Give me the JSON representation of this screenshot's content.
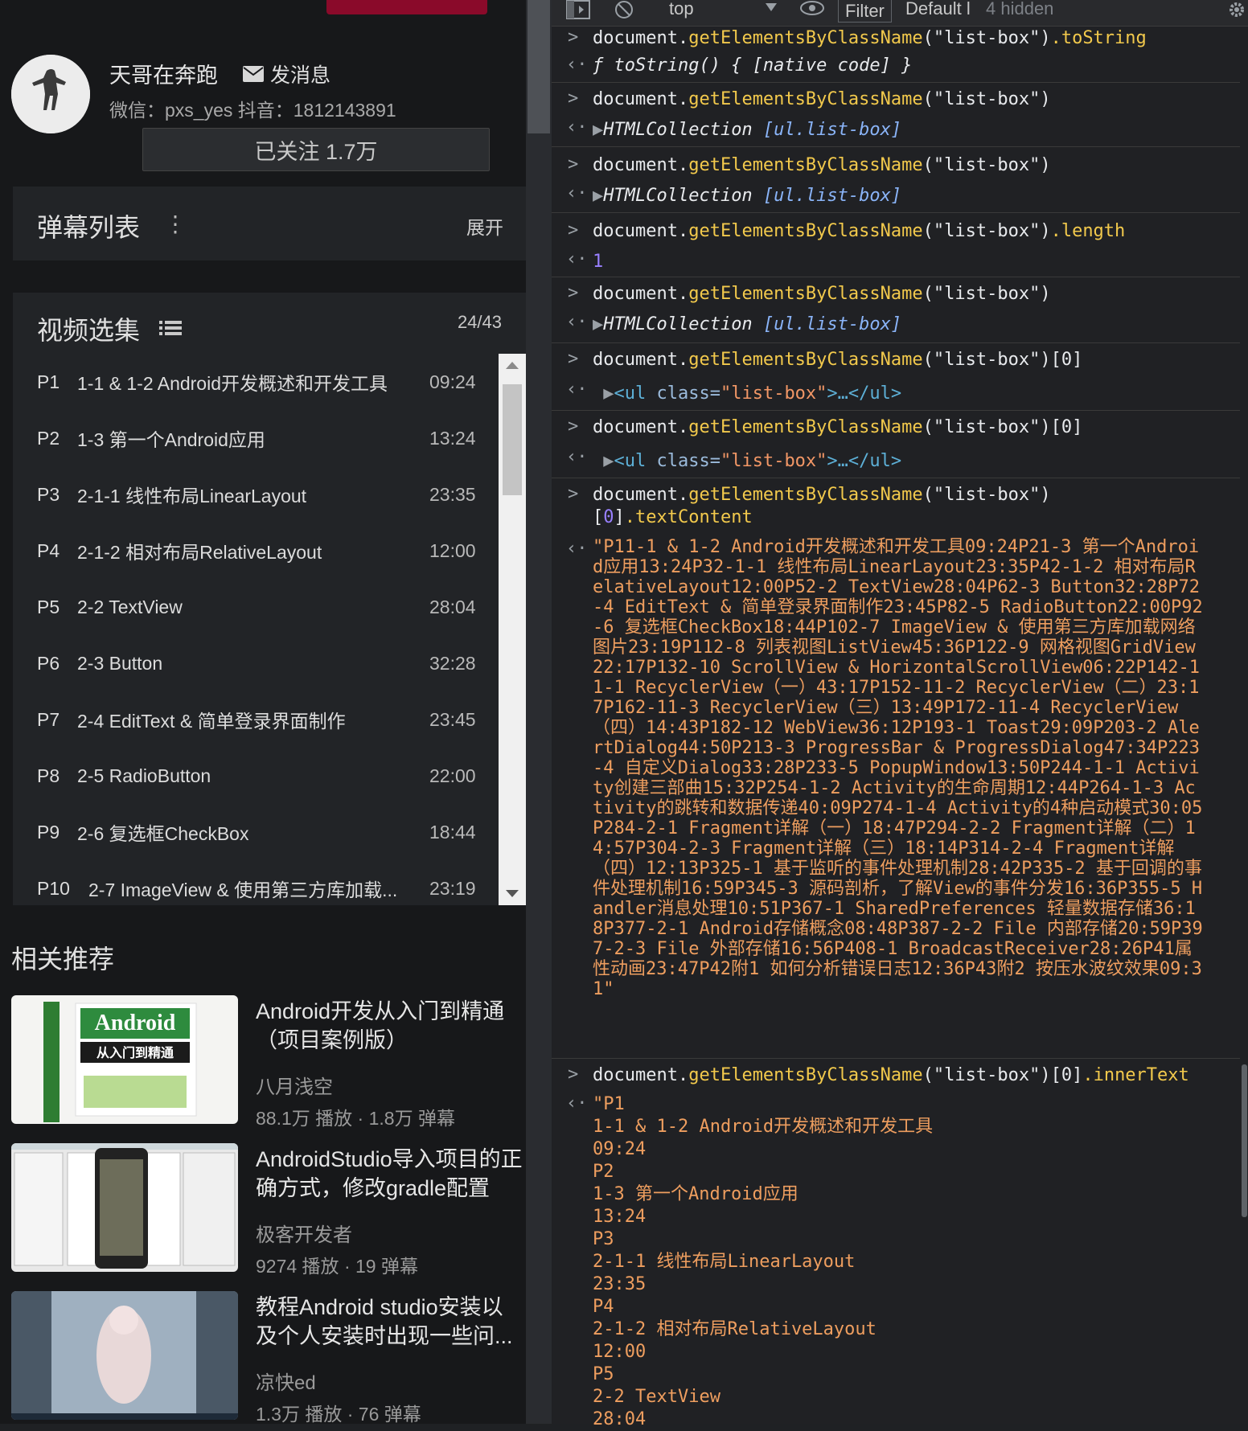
{
  "uploader": {
    "name": "天哥在奔跑",
    "message_label": "发消息",
    "description": "微信：pxs_yes 抖音：1812143891",
    "follow_label": "已关注 1.7万"
  },
  "danmu": {
    "title": "弹幕列表",
    "expand_label": "展开"
  },
  "video_selection": {
    "title": "视频选集",
    "count": "24/43",
    "items": [
      {
        "p": "P1",
        "title": "1-1 & 1-2 Android开发概述和开发工具",
        "duration": "09:24"
      },
      {
        "p": "P2",
        "title": "1-3 第一个Android应用",
        "duration": "13:24"
      },
      {
        "p": "P3",
        "title": "2-1-1 线性布局LinearLayout",
        "duration": "23:35"
      },
      {
        "p": "P4",
        "title": "2-1-2 相对布局RelativeLayout",
        "duration": "12:00"
      },
      {
        "p": "P5",
        "title": "2-2 TextView",
        "duration": "28:04"
      },
      {
        "p": "P6",
        "title": "2-3 Button",
        "duration": "32:28"
      },
      {
        "p": "P7",
        "title": "2-4 EditText & 简单登录界面制作",
        "duration": "23:45"
      },
      {
        "p": "P8",
        "title": "2-5 RadioButton",
        "duration": "22:00"
      },
      {
        "p": "P9",
        "title": "2-6 复选框CheckBox",
        "duration": "18:44"
      },
      {
        "p": "P10",
        "title": "2-7 ImageView & 使用第三方库加载...",
        "duration": "23:19"
      }
    ]
  },
  "recommend": {
    "title": "相关推荐",
    "items": [
      {
        "title": "Android开发从入门到精通（项目案例版）",
        "author": "八月浅空",
        "stats": "88.1万 播放 · 1.8万 弹幕",
        "thumb_text": "Android",
        "thumb_sub": "从入门到精通"
      },
      {
        "title": "AndroidStudio导入项目的正确方式，修改gradle配置",
        "author": "极客开发者",
        "stats": "9274 播放 · 19 弹幕"
      },
      {
        "title": "教程Android studio安装以及个人安装时出现一些问...",
        "author": "凉快ed",
        "stats": "1.3万 播放 · 76 弹幕"
      }
    ]
  },
  "devtools": {
    "toolbar": {
      "context": "top",
      "filter_placeholder": "Filter",
      "levels": "Default l",
      "hidden": "4 hidden"
    },
    "console": {
      "doc": "document.",
      "fn": "getElementsByClassName",
      "arg": "(\"list-box\")",
      "tostring_prop": ".toString",
      "tostring_result": "ƒ toString() { [native code] }",
      "collection_label": "HTMLCollection",
      "collection_content": "[ul.list-box]",
      "length_prop": ".length",
      "length_value": "1",
      "index": "[0]",
      "index_digit": "0",
      "ul_open": "<ul",
      "ul_attr": " class=",
      "ul_attr_val": "\"list-box\"",
      "ul_close": ">…</ul>",
      "textcontent_prop": ".textContent",
      "innertext_prop": ".innerText",
      "textcontent_result": "\"P11-1 & 1-2 Android开发概述和开发工具09:24P21-3 第一个Android应用13:24P32-1-1 线性布局LinearLayout23:35P42-1-2 相对布局RelativeLayout12:00P52-2 TextView28:04P62-3 Button32:28P72-4 EditText & 简单登录界面制作23:45P82-5 RadioButton22:00P92-6 复选框CheckBox18:44P102-7 ImageView & 使用第三方库加载网络图片23:19P112-8 列表视图ListView45:36P122-9 网格视图GridView22:17P132-10 ScrollView & HorizontalScrollView06:22P142-11-1 RecyclerView（一）43:17P152-11-2 RecyclerView（二）23:17P162-11-3 RecyclerView（三）13:49P172-11-4 RecyclerView（四）14:43P182-12 WebView36:12P193-1 Toast29:09P203-2 AlertDialog44:50P213-3 ProgressBar & ProgressDialog47:34P223-4 自定义Dialog33:28P233-5 PopupWindow13:50P244-1-1 Activity创建三部曲15:32P254-1-2 Activity的生命周期12:44P264-1-3 Activity的跳转和数据传递40:09P274-1-4 Activity的4种启动模式30:05P284-2-1 Fragment详解（一）18:47P294-2-2 Fragment详解（二）14:57P304-2-3 Fragment详解（三）18:14P314-2-4 Fragment详解（四）12:13P325-1 基于监听的事件处理机制28:42P335-2 基于回调的事件处理机制16:59P345-3 源码剖析，了解View的事件分发16:36P355-5 Handler消息处理10:51P367-1 SharedPreferences 轻量数据存储36:18P377-2-1 Android存储概念08:48P387-2-2 File 内部存储20:59P397-2-3 File 外部存储16:56P408-1 BroadcastReceiver28:26P41属性动画23:47P42附1 如何分析错误日志12:36P43附2 按压水波纹效果09:31\"",
      "innertext_lines": [
        "\"P1",
        "1-1 & 1-2 Android开发概述和开发工具",
        "09:24",
        "P2",
        "1-3 第一个Android应用",
        "13:24",
        "P3",
        "2-1-1 线性布局LinearLayout",
        "23:35",
        "P4",
        "2-1-2 相对布局RelativeLayout",
        "12:00",
        "P5",
        "2-2 TextView",
        "28:04"
      ]
    }
  }
}
